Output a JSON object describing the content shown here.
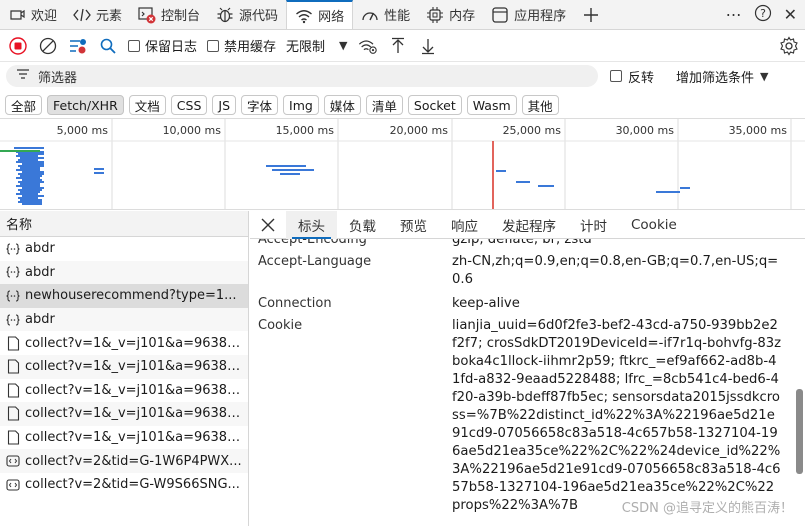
{
  "tabs": [
    {
      "label": "欢迎",
      "icon": "welcome-icon"
    },
    {
      "label": "元素",
      "icon": "code-brackets-icon"
    },
    {
      "label": "控制台",
      "icon": "console-icon"
    },
    {
      "label": "源代码",
      "icon": "sources-bug-icon"
    },
    {
      "label": "网络",
      "icon": "wifi-icon"
    },
    {
      "label": "性能",
      "icon": "performance-icon"
    },
    {
      "label": "内存",
      "icon": "memory-chip-icon"
    },
    {
      "label": "应用程序",
      "icon": "application-icon"
    }
  ],
  "toolbar": {
    "preserve_log": "保留日志",
    "disable_cache": "禁用缓存",
    "throttle": "无限制"
  },
  "filter": {
    "placeholder": "筛选器",
    "invert": "反转",
    "add_filter": "增加筛选条件"
  },
  "chips": [
    "全部",
    "Fetch/XHR",
    "文档",
    "CSS",
    "JS",
    "字体",
    "Img",
    "媒体",
    "清单",
    "Socket",
    "Wasm",
    "其他"
  ],
  "overview": {
    "ticks": [
      "5,000 ms",
      "10,000 ms",
      "15,000 ms",
      "20,000 ms",
      "25,000 ms",
      "30,000 ms",
      "35,000 ms"
    ]
  },
  "requests": {
    "header": "名称",
    "items": [
      {
        "name": "abdr",
        "type": "xhr"
      },
      {
        "name": "abdr",
        "type": "xhr"
      },
      {
        "name": "newhouserecommend?type=1...",
        "type": "xhr"
      },
      {
        "name": "abdr",
        "type": "xhr"
      },
      {
        "name": "collect?v=1&_v=j101&a=96382...",
        "type": "doc"
      },
      {
        "name": "collect?v=1&_v=j101&a=96382...",
        "type": "doc"
      },
      {
        "name": "collect?v=1&_v=j101&a=96382...",
        "type": "doc"
      },
      {
        "name": "collect?v=1&_v=j101&a=96382...",
        "type": "doc"
      },
      {
        "name": "collect?v=1&_v=j101&a=96382...",
        "type": "doc"
      },
      {
        "name": "collect?v=2&tid=G-1W6P4PWX...",
        "type": "fetch"
      },
      {
        "name": "collect?v=2&tid=G-W9S66SNG...",
        "type": "fetch"
      }
    ]
  },
  "details": {
    "tabs": [
      "标头",
      "负载",
      "预览",
      "响应",
      "发起程序",
      "计时",
      "Cookie"
    ],
    "partial_top": {
      "name": "Accept-Encoding",
      "value": "gzip, deflate, br, zstd"
    },
    "rows": [
      {
        "name": "Accept-Language",
        "value": "zh-CN,zh;q=0.9,en;q=0.8,en-GB;q=0.7,en-US;q=0.6"
      },
      {
        "name": "Connection",
        "value": "keep-alive"
      },
      {
        "name": "Cookie",
        "value": "lianjia_uuid=6d0f2fe3-bef2-43cd-a750-939bb2e2f2f7; crosSdkDT2019DeviceId=-if7r1q-bohvfg-83zboka4c1llock-iihmr2p59; ftkrc_=ef9af662-ad8b-41fd-a832-9eaad5228488; lfrc_=8cb541c4-bed6-4f20-a39b-bdeff87fb5ec; sensorsdata2015jssdkcross=%7B%22distinct_id%22%3A%22196ae5d21e91cd9-07056658c83a518-4c657b58-1327104-196ae5d21ea35ce%22%2C%22%24device_id%22%3A%22196ae5d21e91cd9-07056658c83a518-4c657b58-1327104-196ae5d21ea35ce%22%2C%22props%22%3A%7B"
      }
    ]
  },
  "watermark": "CSDN @追寻定义的熊百涛！",
  "colors": {
    "accent": "#0f6cbd",
    "record": "#e81123",
    "bar": "#3a78d8"
  }
}
